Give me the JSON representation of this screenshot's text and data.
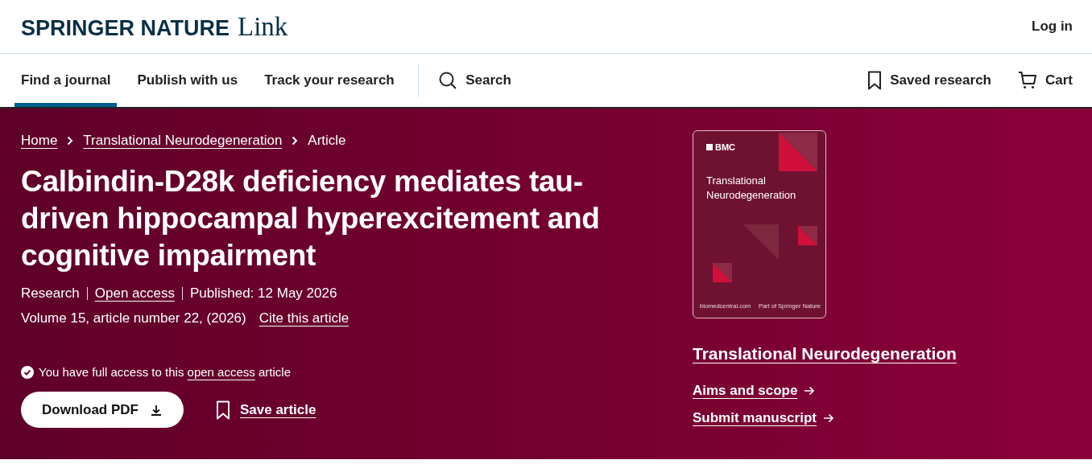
{
  "header": {
    "logo_bold": "SPRINGER NATURE",
    "logo_light": "Link",
    "login": "Log in"
  },
  "nav": {
    "items": [
      {
        "label": "Find a journal",
        "selected": true
      },
      {
        "label": "Publish with us",
        "selected": false
      },
      {
        "label": "Track your research",
        "selected": false
      }
    ],
    "search": "Search",
    "saved": "Saved research",
    "cart": "Cart"
  },
  "breadcrumbs": [
    {
      "label": "Home",
      "link": true
    },
    {
      "label": "Translational Neurodegeneration",
      "link": true
    },
    {
      "label": "Article",
      "link": false
    }
  ],
  "article": {
    "title": "Calbindin-D28k deficiency mediates tau-driven hippocampal hyperexcitement and cognitive impairment",
    "type": "Research",
    "open_access": "Open access",
    "published": "Published: 12 May 2026",
    "volume": "Volume 15, article number 22, (2026)",
    "cite": "Cite this article",
    "access_before": "You have full access to this",
    "access_link": "open access",
    "access_after": "article",
    "download": "Download PDF",
    "save": "Save article"
  },
  "journal": {
    "cover": {
      "publisher": "BMC",
      "title_line1": "Translational",
      "title_line2": "Neurodegeneration",
      "site": "biomedcentral.com",
      "footer": "Part of Springer Nature"
    },
    "name": "Translational Neurodegeneration",
    "links": [
      "Aims and scope",
      "Submit manuscript"
    ]
  }
}
